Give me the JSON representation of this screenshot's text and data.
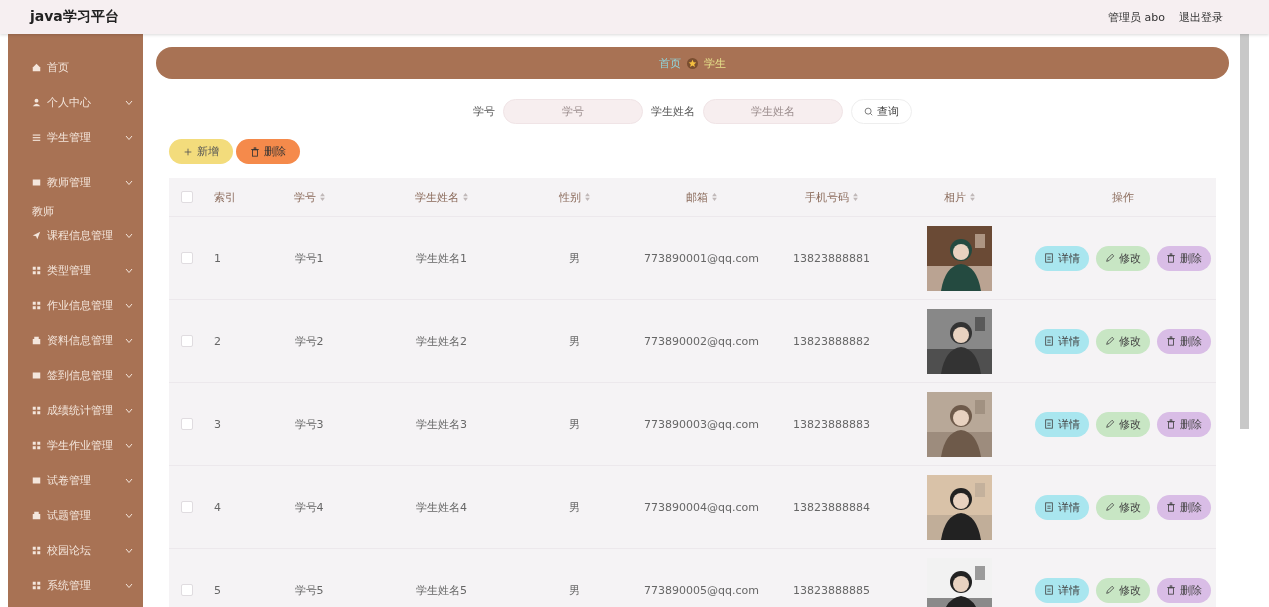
{
  "header": {
    "title": "java学习平台",
    "user": "管理员 abo",
    "logout": "退出登录"
  },
  "sidebar": {
    "items": [
      {
        "kind": "item",
        "label": "首页",
        "expandable": false
      },
      {
        "kind": "item",
        "label": "个人中心",
        "expandable": true
      },
      {
        "kind": "item",
        "label": "学生管理",
        "expandable": true
      },
      {
        "kind": "item",
        "label": "教师管理",
        "expandable": true
      },
      {
        "kind": "section",
        "label": "教师"
      },
      {
        "kind": "item",
        "label": "课程信息管理",
        "expandable": true
      },
      {
        "kind": "item",
        "label": "类型管理",
        "expandable": true
      },
      {
        "kind": "item",
        "label": "作业信息管理",
        "expandable": true
      },
      {
        "kind": "item",
        "label": "资料信息管理",
        "expandable": true
      },
      {
        "kind": "item",
        "label": "签到信息管理",
        "expandable": true
      },
      {
        "kind": "item",
        "label": "成绩统计管理",
        "expandable": true
      },
      {
        "kind": "item",
        "label": "学生作业管理",
        "expandable": true
      },
      {
        "kind": "item",
        "label": "试卷管理",
        "expandable": true
      },
      {
        "kind": "item",
        "label": "试题管理",
        "expandable": true
      },
      {
        "kind": "item",
        "label": "校园论坛",
        "expandable": true
      },
      {
        "kind": "item",
        "label": "系统管理",
        "expandable": true
      }
    ]
  },
  "breadcrumb": [
    "首页",
    "学生"
  ],
  "search": {
    "fields": [
      {
        "label": "学号",
        "placeholder": "学号"
      },
      {
        "label": "学生姓名",
        "placeholder": "学生姓名"
      }
    ],
    "button": "查询"
  },
  "toolbar": [
    {
      "kind": "add",
      "label": "新增"
    },
    {
      "kind": "delete",
      "label": "删除"
    }
  ],
  "table": {
    "header_checked": false,
    "columns": [
      {
        "label": "索引",
        "sortable": false
      },
      {
        "label": "学号",
        "sortable": true
      },
      {
        "label": "学生姓名",
        "sortable": true
      },
      {
        "label": "性别",
        "sortable": true
      },
      {
        "label": "邮箱",
        "sortable": true
      },
      {
        "label": "手机号码",
        "sortable": true
      },
      {
        "label": "相片",
        "sortable": true
      },
      {
        "label": "操作",
        "sortable": false
      }
    ],
    "rows": [
      {
        "checked": false,
        "cells": [
          "1",
          "学号1",
          "学生姓名1",
          "男",
          "773890001@qq.com",
          "13823888881"
        ],
        "actions": [
          {
            "kind": "detail",
            "label": "详情"
          },
          {
            "kind": "edit",
            "label": "修改"
          },
          {
            "kind": "delete",
            "label": "删除"
          }
        ]
      },
      {
        "checked": false,
        "cells": [
          "2",
          "学号2",
          "学生姓名2",
          "男",
          "773890002@qq.com",
          "13823888882"
        ],
        "actions": [
          {
            "kind": "detail",
            "label": "详情"
          },
          {
            "kind": "edit",
            "label": "修改"
          },
          {
            "kind": "delete",
            "label": "删除"
          }
        ]
      },
      {
        "checked": false,
        "cells": [
          "3",
          "学号3",
          "学生姓名3",
          "男",
          "773890003@qq.com",
          "13823888883"
        ],
        "actions": [
          {
            "kind": "detail",
            "label": "详情"
          },
          {
            "kind": "edit",
            "label": "修改"
          },
          {
            "kind": "delete",
            "label": "删除"
          }
        ]
      },
      {
        "checked": false,
        "cells": [
          "4",
          "学号4",
          "学生姓名4",
          "男",
          "773890004@qq.com",
          "13823888884"
        ],
        "actions": [
          {
            "kind": "detail",
            "label": "详情"
          },
          {
            "kind": "edit",
            "label": "修改"
          },
          {
            "kind": "delete",
            "label": "删除"
          }
        ]
      },
      {
        "checked": false,
        "cells": [
          "5",
          "学号5",
          "学生姓名5",
          "男",
          "773890005@qq.com",
          "13823888885"
        ],
        "actions": [
          {
            "kind": "detail",
            "label": "详情"
          },
          {
            "kind": "edit",
            "label": "修改"
          },
          {
            "kind": "delete",
            "label": "删除"
          }
        ]
      }
    ]
  }
}
